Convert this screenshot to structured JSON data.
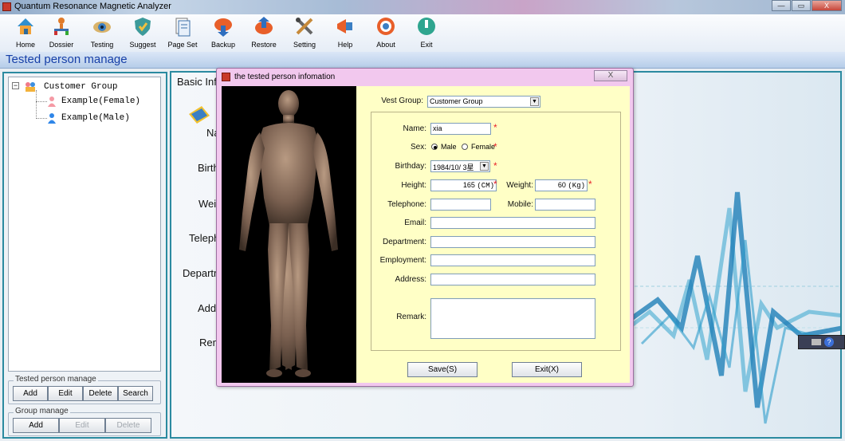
{
  "window": {
    "title": "Quantum Resonance Magnetic Analyzer"
  },
  "toolbar": [
    {
      "label": "Home",
      "icon": "home-icon"
    },
    {
      "label": "Dossier",
      "icon": "dossier-icon"
    },
    {
      "label": "Testing",
      "icon": "testing-icon"
    },
    {
      "label": "Suggest",
      "icon": "suggest-icon"
    },
    {
      "label": "Page Set",
      "icon": "page-set-icon"
    },
    {
      "label": "Backup",
      "icon": "backup-icon"
    },
    {
      "label": "Restore",
      "icon": "restore-icon"
    },
    {
      "label": "Setting",
      "icon": "setting-icon"
    },
    {
      "label": "Help",
      "icon": "help-icon"
    },
    {
      "label": "About",
      "icon": "about-icon"
    },
    {
      "label": "Exit",
      "icon": "exit-icon"
    }
  ],
  "section_title": "Tested person manage",
  "tree": {
    "root": "Customer Group",
    "items": [
      "Example(Female)",
      "Example(Male)"
    ]
  },
  "tested_group": {
    "label": "Tested person manage",
    "buttons": [
      "Add",
      "Edit",
      "Delete",
      "Search"
    ]
  },
  "group_manage": {
    "label": "Group manage",
    "buttons": [
      "Add",
      "Edit",
      "Delete"
    ]
  },
  "background_panel": {
    "header": "Basic Info",
    "labels": [
      "Na",
      "Birth",
      "Weig",
      "Teleph",
      "Departm",
      "Add",
      "Rem"
    ]
  },
  "dialog": {
    "title": "the tested person infomation",
    "close": "X",
    "vest_group_label": "Vest Group:",
    "vest_group_value": "Customer Group",
    "name_label": "Name:",
    "name_value": "xia",
    "sex_label": "Sex:",
    "sex_male": "Male",
    "sex_female": "Female",
    "sex_selected": "Male",
    "birthday_label": "Birthday:",
    "birthday_value": "1984/10/ 3星",
    "height_label": "Height:",
    "height_value": "165",
    "height_unit": "(CM)",
    "weight_label": "Weight:",
    "weight_value": "60",
    "weight_unit": "(Kg)",
    "telephone_label": "Telephone:",
    "mobile_label": "Mobile:",
    "email_label": "Email:",
    "department_label": "Department:",
    "employment_label": "Employment:",
    "address_label": "Address:",
    "remark_label": "Remark:",
    "required_mark": "*",
    "save_button": "Save(S)",
    "exit_button": "Exit(X)"
  },
  "window_buttons": {
    "minimize": "—",
    "maximize": "▭",
    "close": "X"
  },
  "colors": {
    "accent": "#2b8aa0",
    "title_text": "#1740a8",
    "form_bg": "#ffffc6",
    "dialog_frame": "#f2c8ee",
    "required": "#e8242b"
  }
}
